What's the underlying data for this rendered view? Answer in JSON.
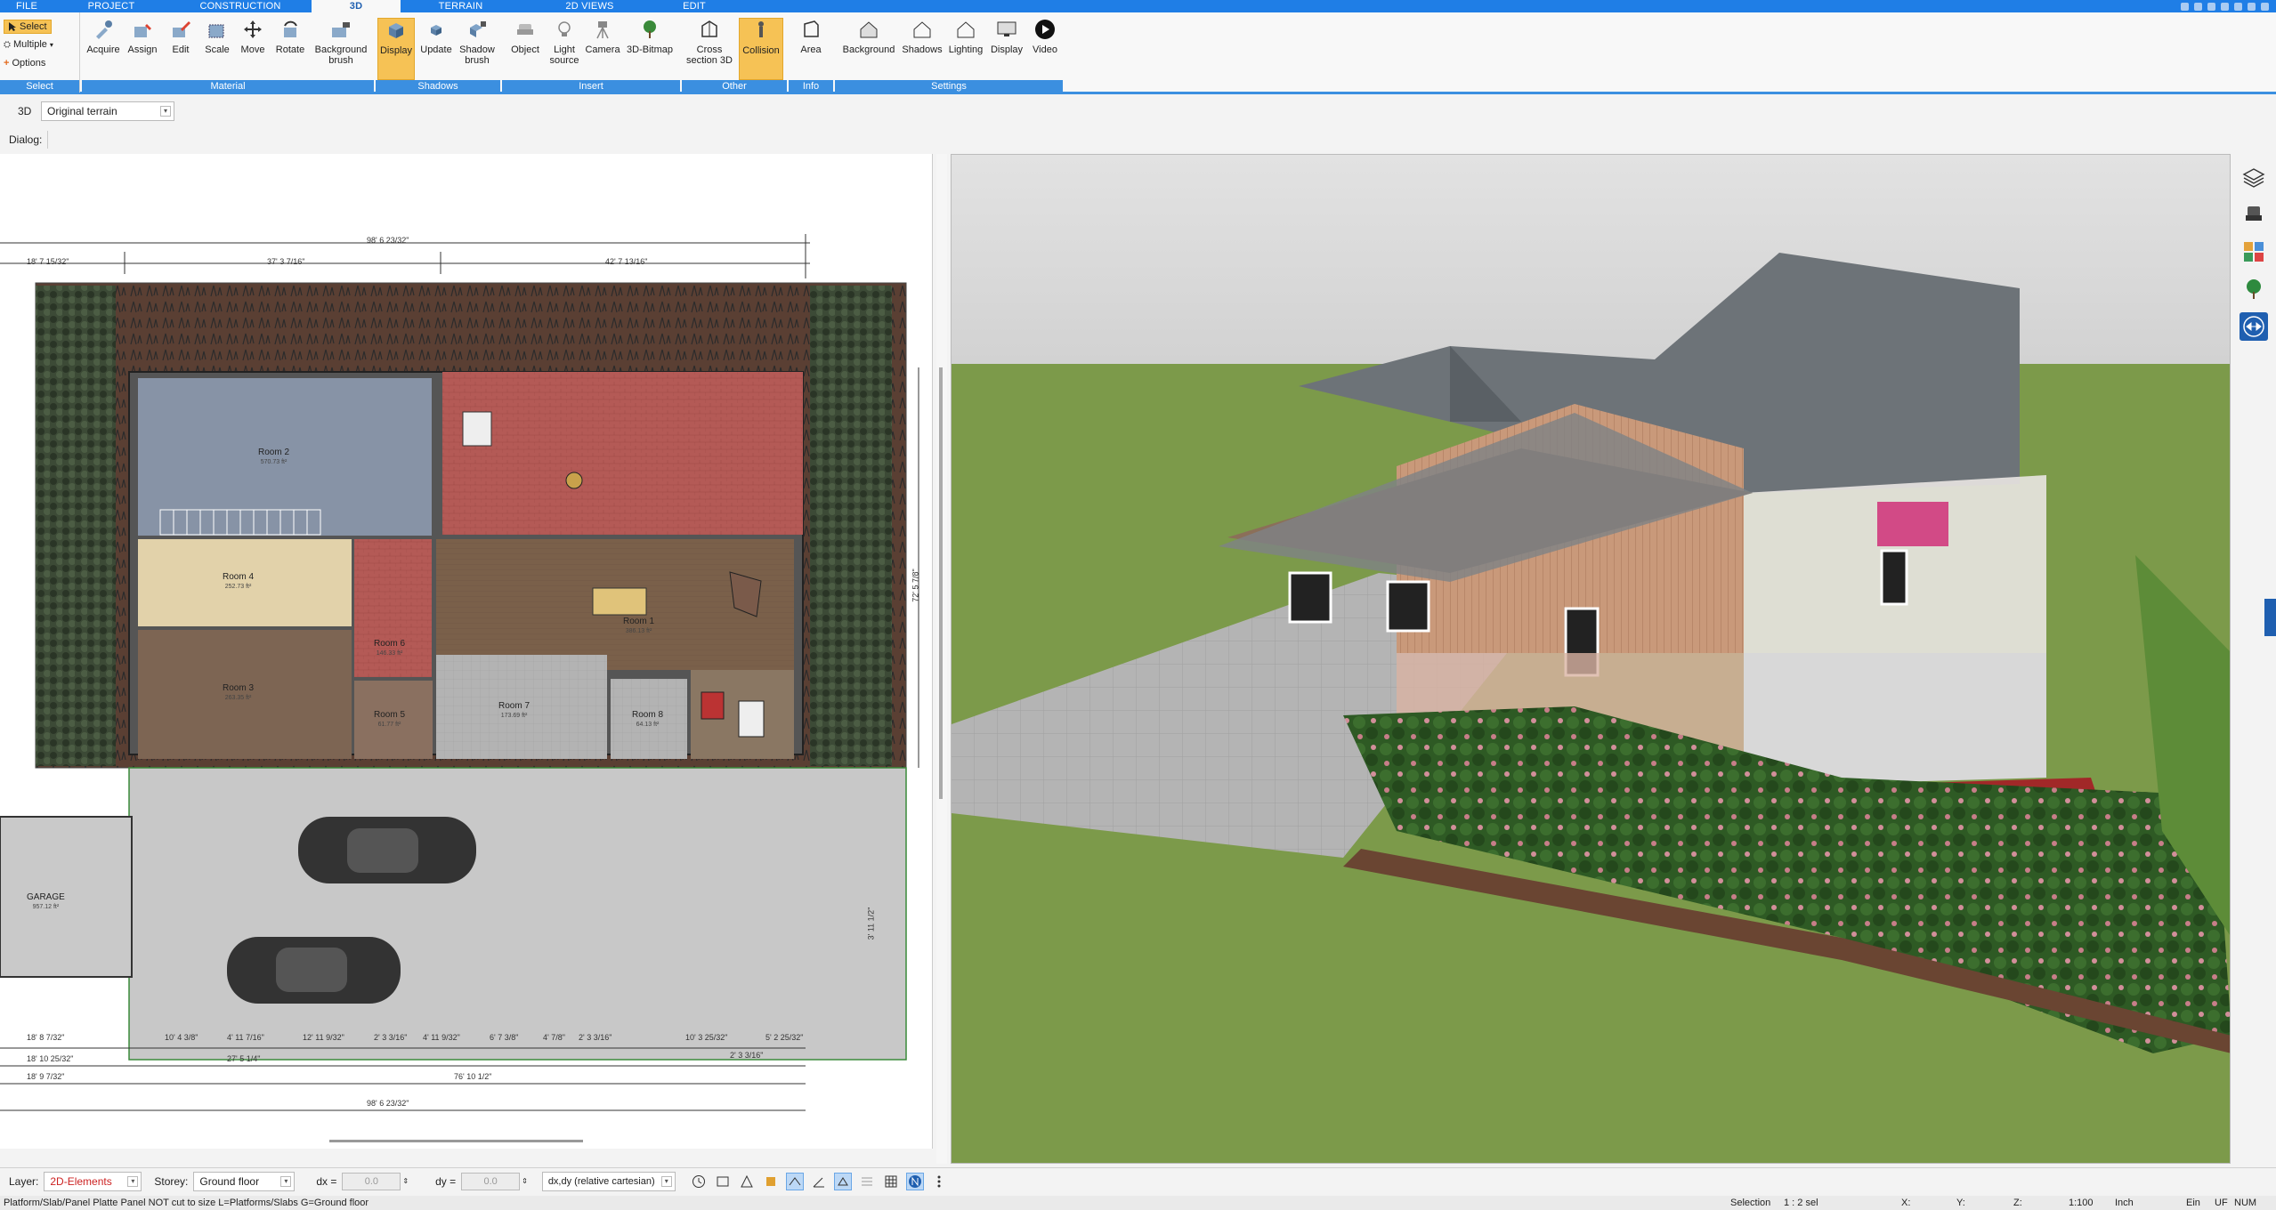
{
  "tabs": [
    "FILE",
    "PROJECT",
    "CONSTRUCTION",
    "3D",
    "TERRAIN",
    "2D VIEWS",
    "EDIT"
  ],
  "active_tab": "3D",
  "ribbon": {
    "select": {
      "select_label": "Select",
      "multiple_label": "Multiple",
      "options_label": "Options",
      "group": "Select"
    },
    "material": {
      "group": "Material",
      "buttons": [
        "Acquire",
        "Assign",
        "Edit",
        "Scale",
        "Move",
        "Rotate",
        "Background brush"
      ]
    },
    "shadows": {
      "group": "Shadows",
      "buttons": [
        "Display",
        "Update",
        "Shadow brush"
      ]
    },
    "insert": {
      "group": "Insert",
      "buttons": [
        "Object",
        "Light source",
        "Camera",
        "3D-Bitmap"
      ]
    },
    "other": {
      "group": "Other",
      "buttons": [
        "Cross section 3D",
        "Collision"
      ]
    },
    "info": {
      "group": "Info",
      "buttons": [
        "Area"
      ]
    },
    "settings": {
      "group": "Settings",
      "buttons": [
        "Background",
        "Shadows",
        "Lighting",
        "Display",
        "Video"
      ]
    }
  },
  "bar3d": {
    "label": "3D",
    "terrain_value": "Original terrain"
  },
  "dialog": {
    "label": "Dialog:"
  },
  "plan": {
    "rooms": [
      {
        "name": "Room 2",
        "area": "570.73 ft²"
      },
      {
        "name": "Room 4",
        "area": "252.73 ft²"
      },
      {
        "name": "Room 3",
        "area": "263.35 ft²"
      },
      {
        "name": "Room 1",
        "area": "386.13 ft²"
      },
      {
        "name": "Room 7",
        "area": "173.69 ft²"
      },
      {
        "name": "Room 5",
        "area": "61.77 ft²"
      },
      {
        "name": "Room 8",
        "area": "64.13 ft²"
      },
      {
        "name": "Room 6",
        "area": "146.33 ft²"
      },
      {
        "name": "GARAGE",
        "area": "957.12 ft²"
      }
    ],
    "dims_top": [
      "98' 6 23/32\"",
      "37' 3 7/16\"",
      "42' 7 13/16\"",
      "18' 7 15/32\""
    ],
    "dims_bottom": [
      "18' 8 7/32\"",
      "10' 4 3/8\"",
      "4' 11 7/16\"",
      "12' 11 9/32\"",
      "2' 3 3/16\"",
      "4' 11 9/32\"",
      "6' 7 3/8\"",
      "4' 7/8\"",
      "2' 3 3/16\"",
      "10' 3 25/32\"",
      "2' 3 3/16\"",
      "5' 2 25/32\"",
      "18' 10 25/32\"",
      "27' 5 1/4\"",
      "76' 10 1/2\"",
      "18' 9 7/32\"",
      "98' 6 23/32\""
    ],
    "dims_right": [
      "72' 5 7/8\"",
      "3' 11 1/2\""
    ]
  },
  "statusbar": {
    "layer_label": "Layer:",
    "layer_value": "2D-Elements",
    "storey_label": "Storey:",
    "storey_value": "Ground floor",
    "dx_label": "dx =",
    "dx_value": "0.0",
    "dy_label": "dy =",
    "dy_value": "0.0",
    "coord_mode": "dx,dy (relative cartesian)"
  },
  "infobar": {
    "hint": "Platform/Slab/Panel Platte Panel NOT cut to size L=Platforms/Slabs G=Ground floor",
    "selection_label": "Selection",
    "selection_value": "1 : 2 sel",
    "x_label": "X:",
    "y_label": "Y:",
    "z_label": "Z:",
    "scale": "1:100",
    "unit": "Inch",
    "mode1": "Ein",
    "mode2": "UF",
    "mode3": "NUM"
  },
  "colors": {
    "accent": "#1f7ee6",
    "ribbon_group": "#3b8fe0",
    "active_button": "#f6c255",
    "grass": "#7c9a4a",
    "sky": "#d9d9d9"
  }
}
